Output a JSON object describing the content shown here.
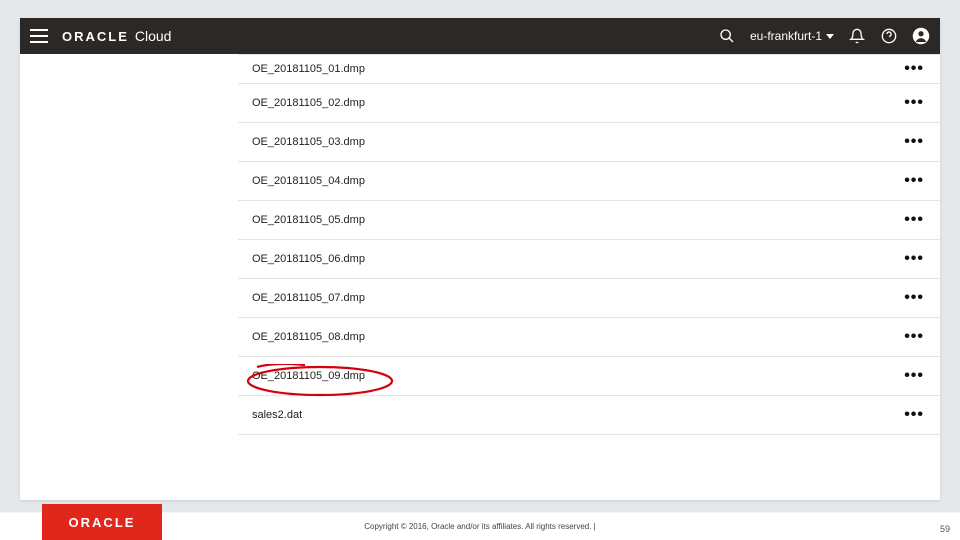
{
  "header": {
    "brand_oracle": "ORACLE",
    "brand_cloud": "Cloud",
    "region": "eu-frankfurt-1"
  },
  "files": [
    {
      "name": "OE_20181105_01.dmp"
    },
    {
      "name": "OE_20181105_02.dmp"
    },
    {
      "name": "OE_20181105_03.dmp"
    },
    {
      "name": "OE_20181105_04.dmp"
    },
    {
      "name": "OE_20181105_05.dmp"
    },
    {
      "name": "OE_20181105_06.dmp"
    },
    {
      "name": "OE_20181105_07.dmp"
    },
    {
      "name": "OE_20181105_08.dmp"
    },
    {
      "name": "OE_20181105_09.dmp"
    },
    {
      "name": "sales2.dat"
    }
  ],
  "annotation": {
    "circled_index": 7
  },
  "footer": {
    "logo": "ORACLE",
    "copyright": "Copyright © 2016, Oracle and/or its affiliates. All rights reserved.  |",
    "page": "59"
  }
}
